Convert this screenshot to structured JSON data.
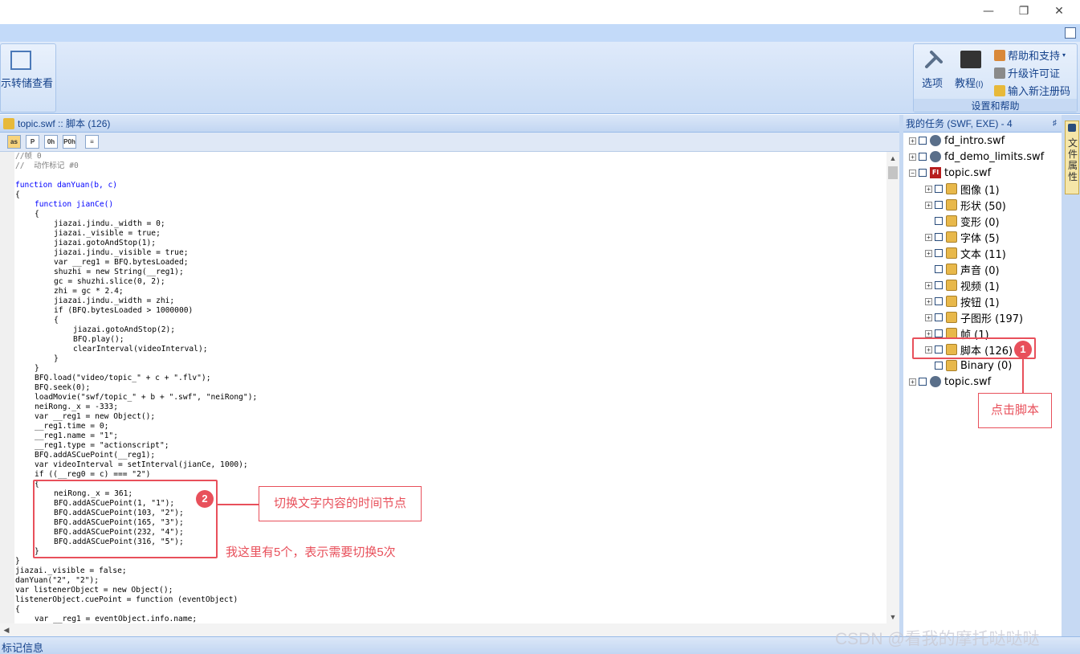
{
  "ribbon": {
    "left_button_label": "示转储查看",
    "options_label": "选项",
    "tutorial_label": "教程",
    "tutorial_hotkey": "(I)",
    "help_support_label": "帮助和支持",
    "upgrade_label": "升级许可证",
    "register_label": "输入新注册码",
    "group_label": "设置和帮助"
  },
  "code_panel": {
    "title": "topic.swf :: 脚本 (126)",
    "toolbar": [
      "as",
      "P",
      "0h",
      "P0h"
    ],
    "lines": [
      {
        "i": 0,
        "t": "//帧 0",
        "c": "cm"
      },
      {
        "i": 0,
        "t": "//  动作标记 #0",
        "c": "cm"
      },
      {
        "i": 0,
        "t": ""
      },
      {
        "i": 0,
        "t": "function danYuan(b, c)",
        "c": "kw"
      },
      {
        "i": 0,
        "t": "{"
      },
      {
        "i": 1,
        "t": "function jianCe()",
        "c": "kw"
      },
      {
        "i": 1,
        "t": "{"
      },
      {
        "i": 2,
        "t": "jiazai.jindu._width = 0;"
      },
      {
        "i": 2,
        "t": "jiazai._visible = true;"
      },
      {
        "i": 2,
        "t": "jiazai.gotoAndStop(1);"
      },
      {
        "i": 2,
        "t": "jiazai.jindu._visible = true;"
      },
      {
        "i": 2,
        "t": "var __reg1 = BFQ.bytesLoaded;"
      },
      {
        "i": 2,
        "t": "shuzhi = new String(__reg1);"
      },
      {
        "i": 2,
        "t": "gc = shuzhi.slice(0, 2);"
      },
      {
        "i": 2,
        "t": "zhi = gc * 2.4;"
      },
      {
        "i": 2,
        "t": "jiazai.jindu._width = zhi;"
      },
      {
        "i": 2,
        "t": "if (BFQ.bytesLoaded > 1000000)"
      },
      {
        "i": 2,
        "t": "{"
      },
      {
        "i": 3,
        "t": "jiazai.gotoAndStop(2);"
      },
      {
        "i": 3,
        "t": "BFQ.play();"
      },
      {
        "i": 3,
        "t": "clearInterval(videoInterval);"
      },
      {
        "i": 2,
        "t": "}"
      },
      {
        "i": 1,
        "t": "}"
      },
      {
        "i": 1,
        "t": "BFQ.load(\"video/topic_\" + c + \".flv\");"
      },
      {
        "i": 1,
        "t": "BFQ.seek(0);"
      },
      {
        "i": 1,
        "t": "loadMovie(\"swf/topic_\" + b + \".swf\", \"neiRong\");"
      },
      {
        "i": 1,
        "t": "neiRong._x = -333;"
      },
      {
        "i": 1,
        "t": "var __reg1 = new Object();"
      },
      {
        "i": 1,
        "t": "__reg1.time = 0;"
      },
      {
        "i": 1,
        "t": "__reg1.name = \"1\";"
      },
      {
        "i": 1,
        "t": "__reg1.type = \"actionscript\";"
      },
      {
        "i": 1,
        "t": "BFQ.addASCuePoint(__reg1);"
      },
      {
        "i": 1,
        "t": "var videoInterval = setInterval(jianCe, 1000);"
      },
      {
        "i": 1,
        "t": "if ((__reg0 = c) === \"2\")"
      },
      {
        "i": 1,
        "t": "{"
      },
      {
        "i": 2,
        "t": "neiRong._x = 361;"
      },
      {
        "i": 2,
        "t": "BFQ.addASCuePoint(1, \"1\");"
      },
      {
        "i": 2,
        "t": "BFQ.addASCuePoint(103, \"2\");"
      },
      {
        "i": 2,
        "t": "BFQ.addASCuePoint(165, \"3\");"
      },
      {
        "i": 2,
        "t": "BFQ.addASCuePoint(232, \"4\");"
      },
      {
        "i": 2,
        "t": "BFQ.addASCuePoint(316, \"5\");"
      },
      {
        "i": 1,
        "t": "}"
      },
      {
        "i": 0,
        "t": "}"
      },
      {
        "i": 0,
        "t": "jiazai._visible = false;"
      },
      {
        "i": 0,
        "t": "danYuan(\"2\", \"2\");"
      },
      {
        "i": 0,
        "t": "var listenerObject = new Object();"
      },
      {
        "i": 0,
        "t": "listenerObject.cuePoint = function (eventObject)"
      },
      {
        "i": 0,
        "t": "{"
      },
      {
        "i": 1,
        "t": "var __reg1 = eventObject.info.name;"
      }
    ]
  },
  "tree_panel": {
    "title": "我的任务 (SWF, EXE) - 4",
    "pin": "♯",
    "items": [
      {
        "label": "fd_intro.swf",
        "level": 0,
        "expander": "+",
        "icon": "swf"
      },
      {
        "label": "fd_demo_limits.swf",
        "level": 0,
        "expander": "+",
        "icon": "swf"
      },
      {
        "label": "topic.swf",
        "level": 0,
        "expander": "−",
        "icon": "fl"
      },
      {
        "label": "图像 (1)",
        "level": 1,
        "expander": "+",
        "icon": "folder"
      },
      {
        "label": "形状 (50)",
        "level": 1,
        "expander": "+",
        "icon": "folder"
      },
      {
        "label": "变形 (0)",
        "level": 1,
        "expander": "",
        "icon": "folder"
      },
      {
        "label": "字体 (5)",
        "level": 1,
        "expander": "+",
        "icon": "folder"
      },
      {
        "label": "文本 (11)",
        "level": 1,
        "expander": "+",
        "icon": "folder"
      },
      {
        "label": "声音 (0)",
        "level": 1,
        "expander": "",
        "icon": "folder"
      },
      {
        "label": "视频 (1)",
        "level": 1,
        "expander": "+",
        "icon": "folder"
      },
      {
        "label": "按钮 (1)",
        "level": 1,
        "expander": "+",
        "icon": "folder"
      },
      {
        "label": "子图形 (197)",
        "level": 1,
        "expander": "+",
        "icon": "folder"
      },
      {
        "label": "帧 (1)",
        "level": 1,
        "expander": "+",
        "icon": "folder"
      },
      {
        "label": "脚本 (126)",
        "level": 1,
        "expander": "+",
        "icon": "folder"
      },
      {
        "label": "Binary (0)",
        "level": 1,
        "expander": "",
        "icon": "folder"
      },
      {
        "label": "topic.swf",
        "level": 0,
        "expander": "+",
        "icon": "swf"
      }
    ]
  },
  "side_tab": {
    "label": "文件属性"
  },
  "status": {
    "label": "标记信息"
  },
  "annotations": {
    "marker1": "1",
    "callout1": "点击脚本",
    "marker2": "2",
    "callout2": "切换文字内容的时间节点",
    "note2": "我这里有5个，表示需要切换5次"
  },
  "watermark": "CSDN @看我的摩托哒哒哒",
  "colors": {
    "annotation": "#e8505b",
    "ribbon": "#c3daf9"
  }
}
